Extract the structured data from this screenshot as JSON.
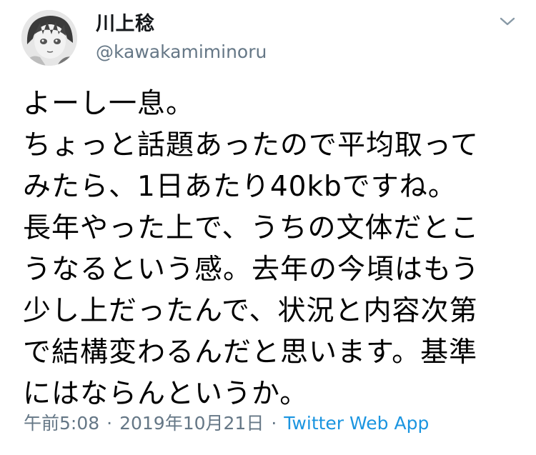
{
  "author": {
    "display_name": "川上稔",
    "handle": "@kawakamiminoru",
    "avatar_icon": "manga-character-avatar"
  },
  "menu": {
    "icon": "chevron-down-icon"
  },
  "tweet": {
    "text": "よーし一息。\nちょっと話題あったので平均取って\nみたら、1日あたり40kbですね。\n長年やった上で、うちの文体だとこ\nうなるという感。去年の今頃はもう\n少し上だったんで、状況と内容次第\nで結構変わるんだと思います。基準\nにはならんというか。"
  },
  "meta": {
    "time": "午前5:08",
    "date": "2019年10月21日",
    "separator": "·",
    "source": "Twitter Web App"
  },
  "colors": {
    "text": "#000000",
    "secondary": "#657786",
    "link": "#1b95e0"
  }
}
